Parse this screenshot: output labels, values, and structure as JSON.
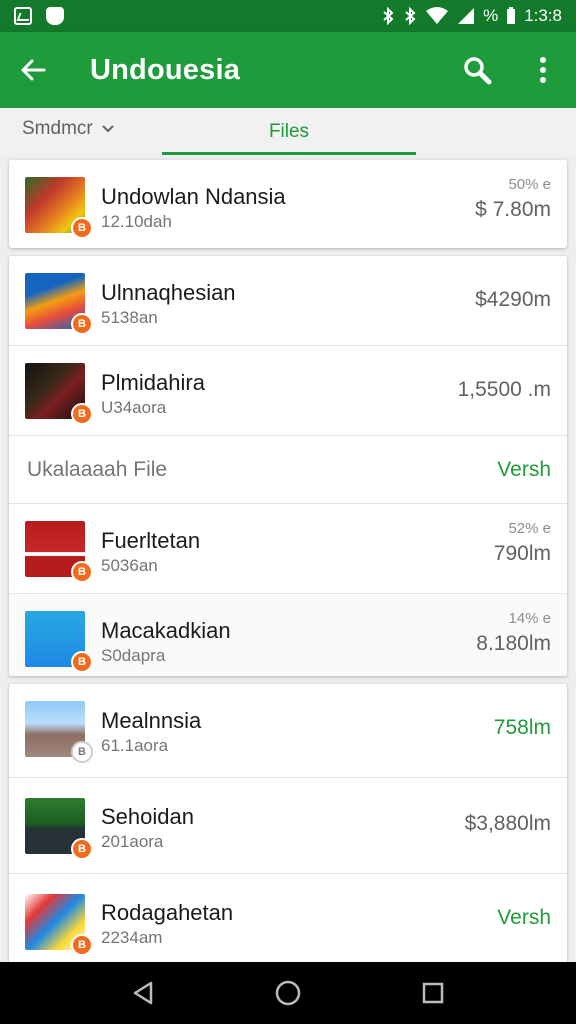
{
  "status_bar": {
    "time": "1:3:8",
    "battery_text": "%"
  },
  "app_bar": {
    "title": "Undouesia"
  },
  "tabs": {
    "sort_label": "Smdmcr",
    "files_label": "Files"
  },
  "group1": [
    {
      "name": "Undowlan Ndansia",
      "sub": "12.10dah",
      "pct": "50% e",
      "size": "$ 7.80m",
      "badge": "B"
    }
  ],
  "group2": [
    {
      "name": "Ulnnaqhesian",
      "sub": "5138an",
      "size": "$4290m",
      "badge": "B"
    },
    {
      "name": "Plmidahira",
      "sub": "U34aora",
      "size": "1,5500 .m",
      "badge": "B"
    }
  ],
  "section": {
    "title": "Ukalaaaah File",
    "action": "Versh"
  },
  "group3": [
    {
      "name": "Fuerltetan",
      "sub": "5036an",
      "pct": "52% e",
      "size": "790lm",
      "badge": "B"
    },
    {
      "name": "Macakadkian",
      "sub": "S0dapra",
      "pct": "14% e",
      "size": "8.180lm",
      "badge": "B"
    }
  ],
  "group4": [
    {
      "name": "Mealnnsia",
      "sub": "61.1aora",
      "size": "758lm",
      "badge": "B"
    },
    {
      "name": "Sehoidan",
      "sub": "201aora",
      "size": "$3,880lm",
      "badge": "B"
    },
    {
      "name": "Rodagahetan",
      "sub": "2234am",
      "size": "Versh",
      "badge": "B"
    }
  ],
  "icons": {
    "back": "arrow-left-icon",
    "search": "search-icon",
    "more": "more-vert-icon",
    "nav_back": "nav-back-icon",
    "nav_home": "nav-home-icon",
    "nav_recent": "nav-recent-icon"
  },
  "colors": {
    "primary": "#1e9b3a",
    "status_bar": "#127a2a",
    "badge": "#ef6c1f"
  }
}
